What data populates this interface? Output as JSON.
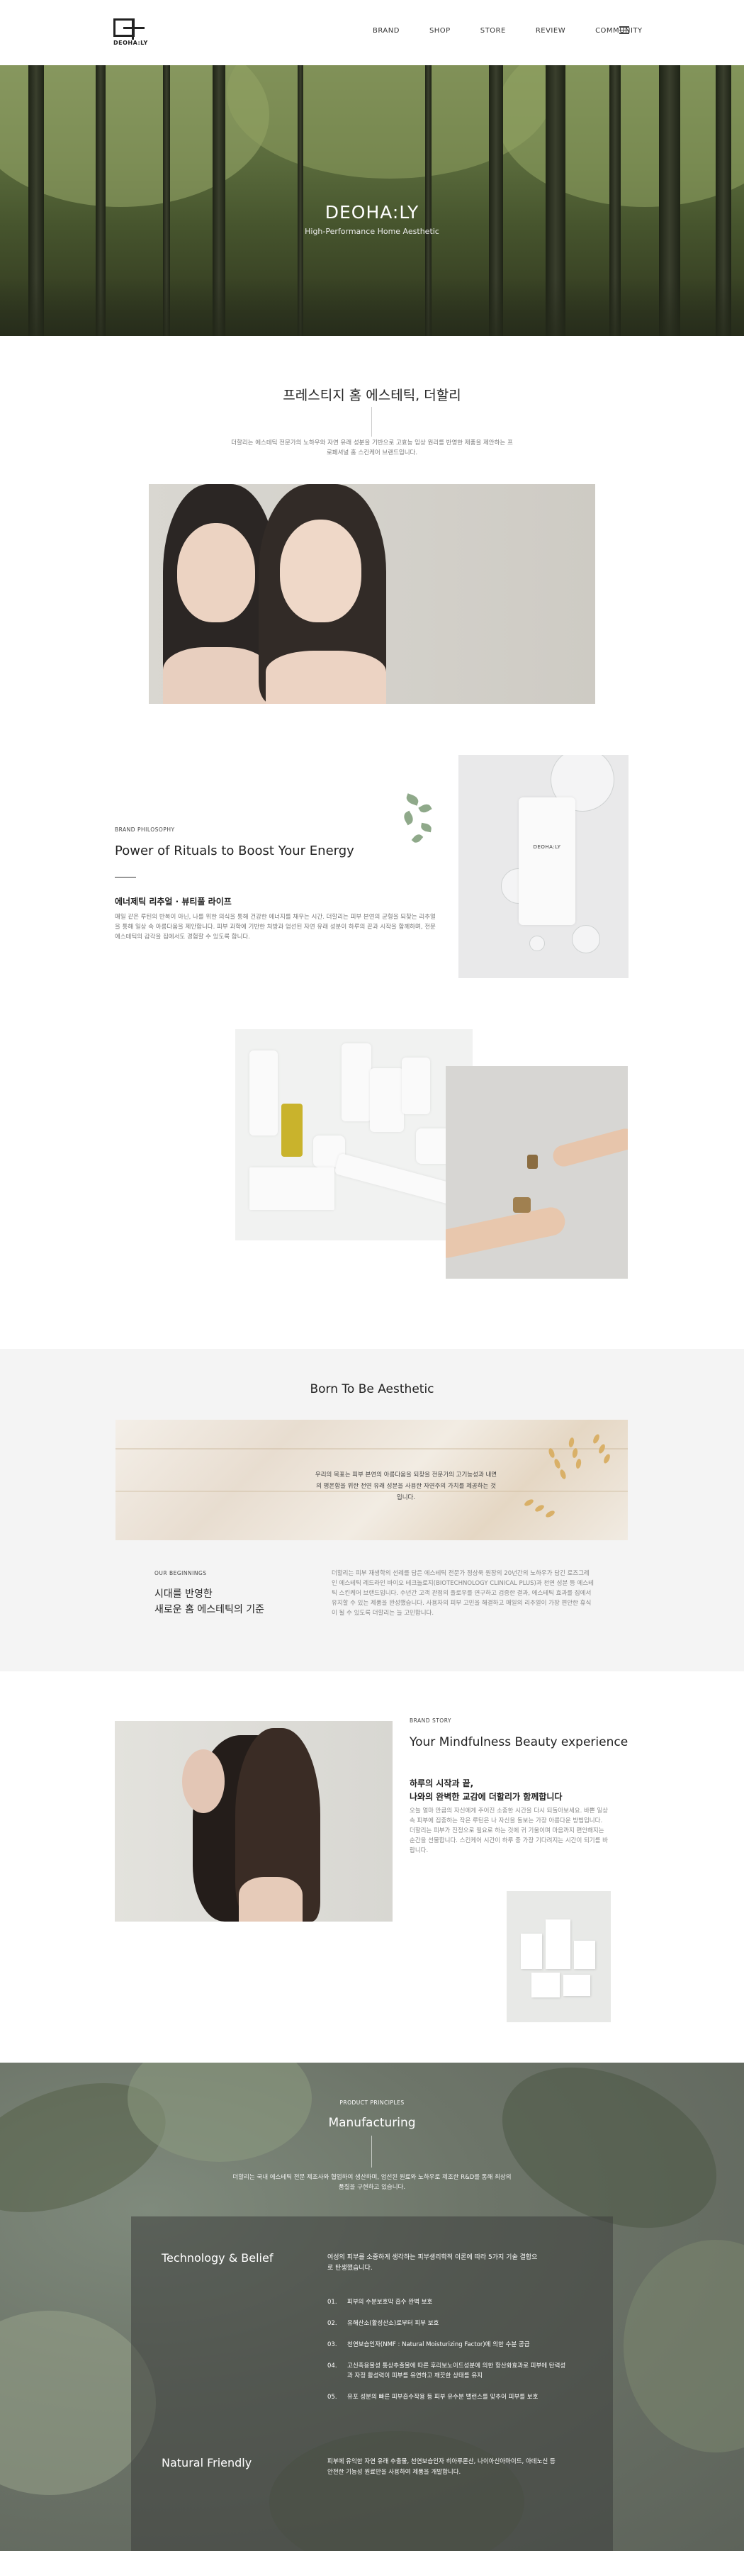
{
  "header": {
    "logo_text": "DEOHA:LY",
    "nav": [
      "BRAND",
      "SHOP",
      "STORE",
      "REVIEW",
      "COMMUNITY"
    ]
  },
  "hero": {
    "title": "DEOHA:LY",
    "subtitle": "High-Performance Home Aesthetic"
  },
  "intro": {
    "title": "프레스티지 홈 에스테틱, 더할리",
    "text": "더할리는 에스테틱 전문가의 노하우와 자연 유래 성분을 기반으로 고효능 임상 원리를 반영한 제품을 제안하는 프로페셔널 홈 스킨케어 브랜드입니다."
  },
  "philosophy": {
    "label": "BRAND PHILOSOPHY",
    "title": "Power of Rituals to Boost Your Energy",
    "subtitle": "에너제틱 리추얼 · 뷰티풀 라이프",
    "text": "매일 같은 루틴의 반복이 아닌, 나를 위한 의식을 통해 건강한 에너지를 채우는 시간. 더할리는 피부 본연의 균형을 되찾는 리추얼을 통해 일상 속 아름다움을 제안합니다. 피부 과학에 기반한 처방과 엄선된 자연 유래 성분이 하루의 끝과 시작을 함께하며, 전문 에스테틱의 감각을 집에서도 경험할 수 있도록 합니다."
  },
  "product": {
    "brand_on_bottle": "DEOHA:LY"
  },
  "born": {
    "title": "Born To Be Aesthetic",
    "banner_text": "우리의 목표는 피부 본연의 아름다움을 되찾을 전문가의 고기능성과 내면의 평온함을 위한 천연 유래 성분을 사용한 자연주의 가치를 제공하는 것입니다.",
    "label": "OUR BEGINNINGS",
    "heading_line1": "시대를 반영한",
    "heading_line2": "새로운 홈 에스테틱의 기준",
    "text": "더할리는 피부 재생학의 선례를 담은 에스테틱 전문가 정상욱 원장의 20년간의 노하우가 담긴 로즈그레인 에스테틱 레드라인 바이오 테크놀로지(BIOTECHNOLOGY CLINICAL PLUS)과 천연 성분 등 에스테틱 스킨케어 브랜드입니다. 수년간 고객 관점의 플로우를 연구하고 검증한 결과, 에스테틱 효과를 집에서 유지할 수 있는 제품을 완성했습니다. 사용자의 피부 고민을 해결하고 매일의 리추얼이 가장 편안한 휴식이 될 수 있도록 더할리는 늘 고민합니다."
  },
  "story": {
    "label": "BRAND STORY",
    "title": "Your Mindfulness Beauty experience",
    "heading_line1": "하루의 시작과 끝,",
    "heading_line2": "나와의 완벽한 교감에 더할리가 함께합니다",
    "text": "오늘 얼마 만큼의 자신에게 주어진 소중한 시간을 다시 되돌아보세요. 바쁜 일상 속 피부에 집중하는 작은 루틴은 나 자신을 돌보는 가장 아름다운 방법입니다. 더할리는 피부가 진정으로 필요로 하는 것에 귀 기울이며 마음까지 편안해지는 순간을 선물합니다. 스킨케어 시간이 하루 중 가장 기다려지는 시간이 되기를 바랍니다."
  },
  "manufacturing": {
    "label": "PRODUCT PRINCIPLES",
    "title": "Manufacturing",
    "text": "더할리는 국내 에스테틱 전문 제조사와 협업하여 생산하며, 엄선된 원료와 노하우로 제조한 R&D를 통해 최상의 품질을 구현하고 있습니다.",
    "tech_title": "Technology & Belief",
    "tech_intro": "여성의 피부를 소중하게 생각하는 피부생리학적 이론에 따라 5가지 기술 결합으로 탄생했습니다.",
    "items": [
      {
        "num": "01.",
        "text": "피부의 수분보호막 흡수 완벽 보호"
      },
      {
        "num": "02.",
        "text": "유해산소(활성산소)로부터 피부 보호"
      },
      {
        "num": "03.",
        "text": "천연보습인자(NMF : Natural Moisturizing Factor)에 의한 수분 공급"
      },
      {
        "num": "04.",
        "text": "고신축용물성 통상추출물에 따른 후리보노이드성분에 의한 항산화효과로 피부에 탄력성과 자정 활성력이 피부를 유연하고 깨끗한 상태를 유지"
      },
      {
        "num": "05.",
        "text": "유포 성분의 빠른 피부흡수작용 등 피부 유수분 밸런스를 맞추어 피부를 보호"
      }
    ],
    "natural_title": "Natural Friendly",
    "natural_text": "피부에 유익한 자연 유래 추출물, 천연보습인자 히아루론산, 나이아신아마이드, 아데노신 등 안전한 기능성 원료만을 사용하여 제품을 개발합니다."
  }
}
